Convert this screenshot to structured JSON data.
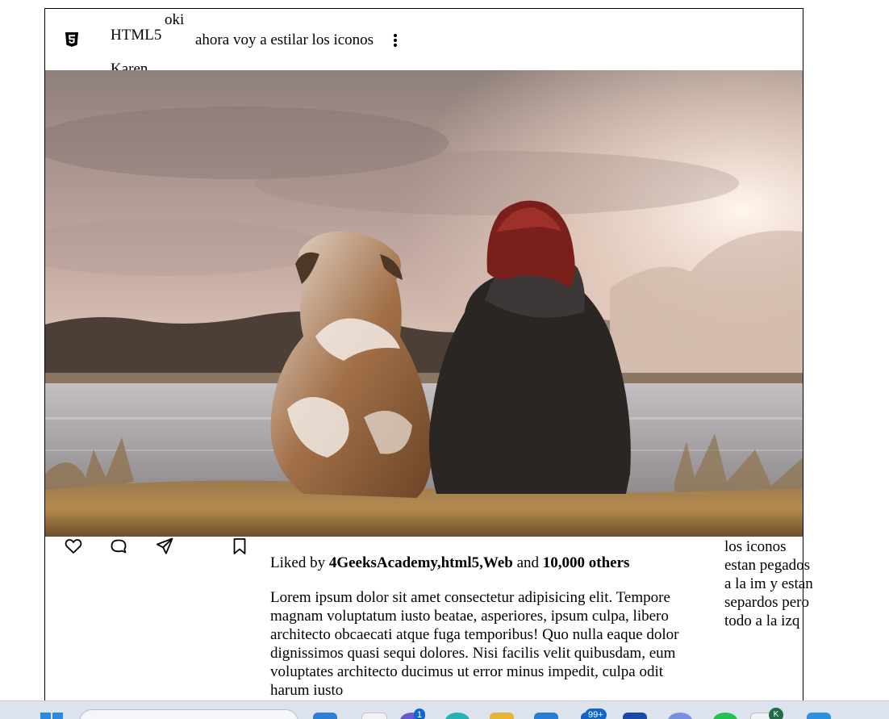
{
  "header": {
    "brand": "HTML5",
    "overlay_note": "oki",
    "author": "Karen",
    "note": "ahora voy a estilar los iconos"
  },
  "post": {
    "photo_alt": "dog and woman by the lake",
    "liked_prefix": "Liked by ",
    "liked_names": "4GeeksAcademy,html5,Web",
    "liked_and": " and ",
    "liked_count": "10,000 others",
    "caption": "Lorem ipsum dolor sit amet consectetur adipisicing elit. Tempore magnam voluptatum iusto beatae, asperiores, ipsum culpa, libero architecto obcaecati atque fuga temporibus! Quo nulla eaque dolor dignissimos quasi sequi dolores. Nisi facilis velit quibusdam, eum voluptates architecto ducimus ut error minus impedit, culpa odit harum iusto"
  },
  "side_note": "los iconos estan pegados a la im y estan separdos pero todo a la izq",
  "icons": {
    "brand": "html5-icon",
    "more": "more-vertical-icon",
    "like": "heart-icon",
    "comment": "comment-icon",
    "share": "send-icon",
    "save": "bookmark-icon"
  },
  "taskbar": {
    "badge_1": "1",
    "badge_99": "99+",
    "avatar_letter": "K"
  },
  "colors": {
    "taskbar_bg": "#dde3ec",
    "badge_bg": "#1166cc"
  }
}
